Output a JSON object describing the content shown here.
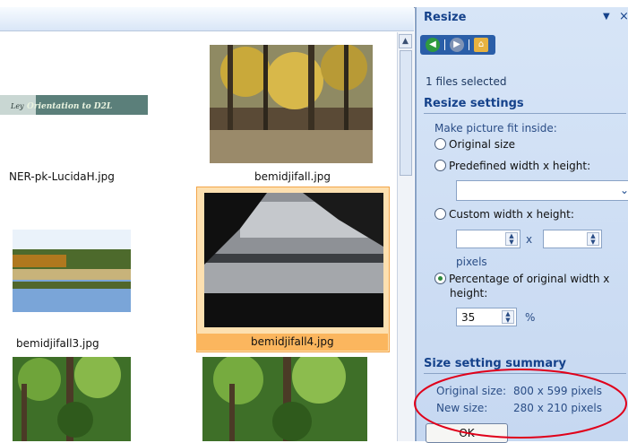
{
  "gallery": {
    "items": [
      {
        "caption": "NER-pk-LucidaH.jpg",
        "banner_text": "Orientation to D2L"
      },
      {
        "caption": "bemidjifall.jpg"
      },
      {
        "caption": "bemidjifall3.jpg"
      },
      {
        "caption": "bemidjifall4.jpg",
        "selected": true
      },
      {
        "caption": ""
      },
      {
        "caption": ""
      }
    ]
  },
  "pane": {
    "title": "Resize",
    "files_selected": "1 files selected",
    "settings_heading": "Resize settings",
    "fit_label": "Make picture fit inside:",
    "options": {
      "original": "Original size",
      "predefined": "Predefined width x height:",
      "custom": "Custom width x height:",
      "percentage_line1": "Percentage of original width x",
      "percentage_line2": "height:"
    },
    "custom_x": "x",
    "pixels_label": "pixels",
    "percentage_value": "35",
    "percent_sign": "%",
    "summary_heading": "Size setting summary",
    "original_size_label": "Original size:",
    "original_size_value": "800 x 599 pixels",
    "new_size_label": "New size:",
    "new_size_value": "280 x 210 pixels",
    "ok_label": "OK"
  },
  "colors": {
    "pane_bg": "#c6d8f1",
    "heading": "#15428b",
    "selection": "#fbb65e",
    "annotation_ellipse": "#e0001a"
  }
}
